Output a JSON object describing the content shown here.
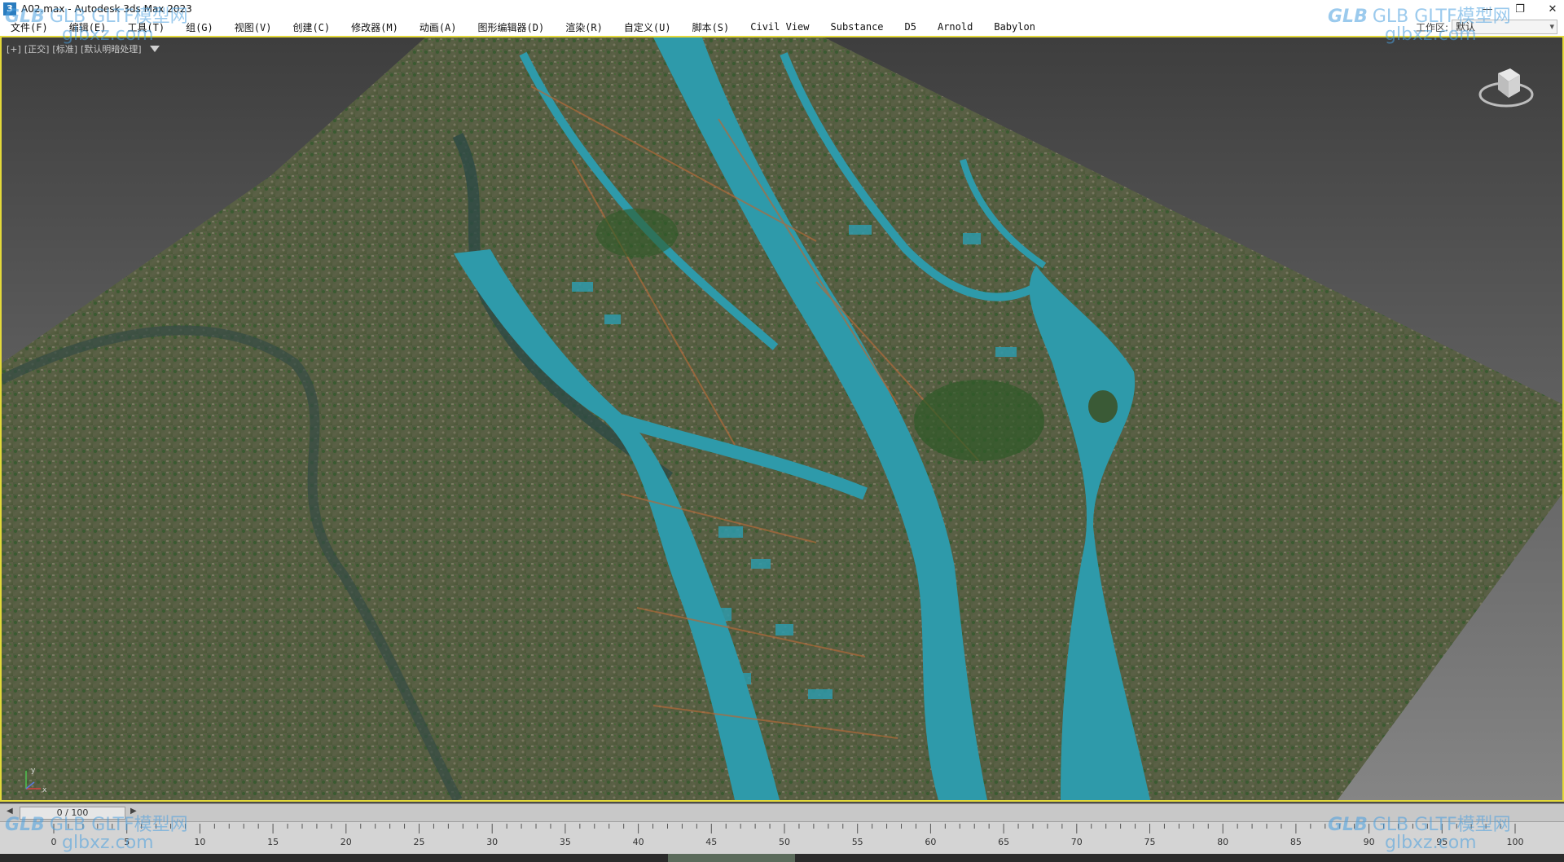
{
  "window": {
    "title": "A02.max - Autodesk 3ds Max 2023",
    "icon": "3ds-max-app-icon",
    "controls": [
      "—",
      "❐",
      "✕"
    ]
  },
  "menu": {
    "items": [
      "文件(F)",
      "编辑(E)",
      "工具(T)",
      "组(G)",
      "视图(V)",
      "创建(C)",
      "修改器(M)",
      "动画(A)",
      "图形编辑器(D)",
      "渲染(R)",
      "自定义(U)",
      "脚本(S)",
      "Civil View",
      "Substance",
      "D5",
      "Arnold",
      "Babylon"
    ],
    "workspace_label": "工作区:",
    "workspace_value": "默认"
  },
  "viewport": {
    "label_plus": "[+]",
    "label_view": "[正交]",
    "label_shading": "[标准]",
    "label_lighting": "[默认明暗处理]",
    "highlight_color": "#e3d93a",
    "water_color": "#2e9aaa"
  },
  "timeline": {
    "frame_display": "0 / 100",
    "ticks": [
      "0",
      "5",
      "10",
      "15",
      "20",
      "25",
      "30",
      "35",
      "40",
      "45",
      "50",
      "55",
      "60",
      "65",
      "70",
      "75",
      "80",
      "85",
      "90",
      "95",
      "100"
    ]
  },
  "watermark": {
    "logo": "GLB",
    "brand": "GLB GLTF模型网",
    "url": "glbxz.com"
  }
}
